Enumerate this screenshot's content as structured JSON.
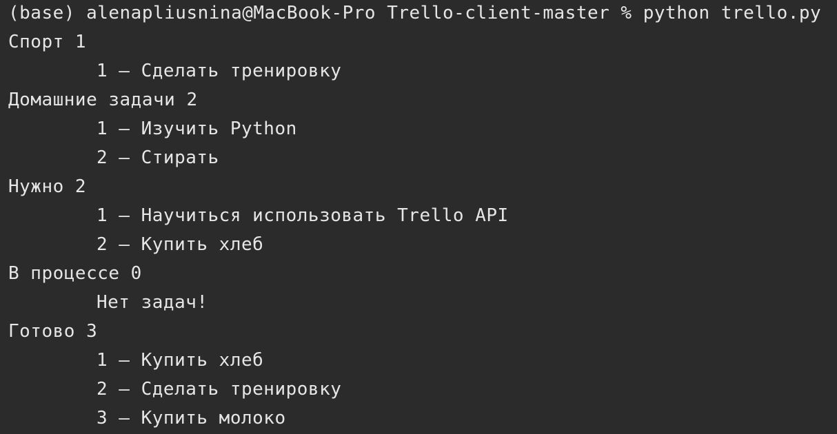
{
  "prompt": {
    "text": "(base) alenapliusnina@MacBook-Pro Trello-client-master % python trello.py"
  },
  "columns": [
    {
      "header": "Спорт 1",
      "tasks": [
        "1 – Сделать тренировку"
      ]
    },
    {
      "header": "Домашние задачи 2",
      "tasks": [
        "1 – Изучить Python",
        "2 – Стирать"
      ]
    },
    {
      "header": "Нужно 2",
      "tasks": [
        "1 – Научиться использовать Trello API",
        "2 – Купить хлеб"
      ]
    },
    {
      "header": "В процессе 0",
      "tasks": [
        "Нет задач!"
      ]
    },
    {
      "header": "Готово 3",
      "tasks": [
        "1 – Купить хлеб",
        "2 – Сделать тренировку",
        "3 – Купить молоко"
      ]
    }
  ],
  "colors": {
    "background": "#2b2b2b",
    "text": "#e6e6e6"
  }
}
